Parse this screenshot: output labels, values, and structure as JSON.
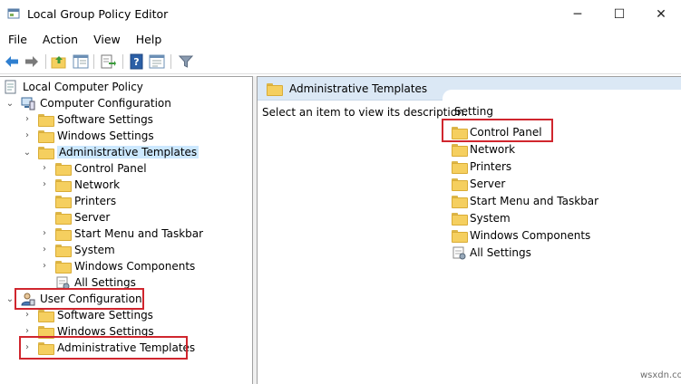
{
  "window": {
    "title": "Local Group Policy Editor",
    "minimize": "─",
    "maximize": "☐",
    "close": "✕"
  },
  "menu": [
    "File",
    "Action",
    "View",
    "Help"
  ],
  "toolbar_icons": [
    "back-arrow-icon",
    "forward-arrow-icon",
    "up-folder-icon",
    "show-hide-tree-icon",
    "export-list-icon",
    "help-icon",
    "properties-icon",
    "filter-icon"
  ],
  "tree": {
    "root": "Local Computer Policy",
    "computer_configuration": "Computer Configuration",
    "cc_software_settings": "Software Settings",
    "cc_windows_settings": "Windows Settings",
    "cc_administrative_templates": "Administrative Templates",
    "at_control_panel": "Control Panel",
    "at_network": "Network",
    "at_printers": "Printers",
    "at_server": "Server",
    "at_start_menu": "Start Menu and Taskbar",
    "at_system": "System",
    "at_windows_components": "Windows Components",
    "at_all_settings": "All Settings",
    "user_configuration": "User Configuration",
    "uc_software_settings": "Software Settings",
    "uc_windows_settings": "Windows Settings",
    "uc_administrative_templates": "Administrative Templates"
  },
  "right_pane": {
    "header": "Administrative Templates",
    "description": "Select an item to view its description.",
    "column_setting": "Setting",
    "items": [
      "Control Panel",
      "Network",
      "Printers",
      "Server",
      "Start Menu and Taskbar",
      "System",
      "Windows Components",
      "All Settings"
    ]
  },
  "colors": {
    "highlight_box": "#d0262e",
    "selection": "#cce8ff",
    "header_bg": "#dbe8f5"
  },
  "watermark": "wsxdn.com"
}
